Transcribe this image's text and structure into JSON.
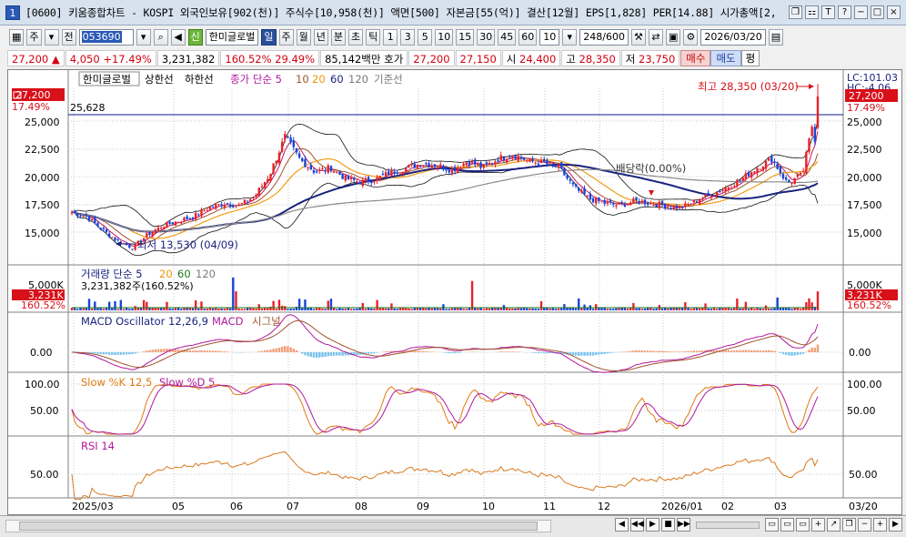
{
  "window": {
    "number": "1",
    "title": "[0600] 키움종합차트 - KOSPI 외국인보유[902(천)] 주식수[10,958(천)] 액면[500] 자본금[55(억)] 결산[12월] EPS[1,828] PER[14.88] 시가총액[2,"
  },
  "toolbar": {
    "mode1": "주",
    "mode2": "전",
    "code": "053690",
    "badge": "신",
    "name": "한미글로벌",
    "periods": [
      "일",
      "주",
      "월",
      "년",
      "분",
      "초",
      "틱"
    ],
    "numbers": [
      "1",
      "3",
      "5",
      "10",
      "15",
      "30",
      "45",
      "60"
    ],
    "select_value": "10",
    "page_count": "248/600",
    "date": "2026/03/20"
  },
  "info": {
    "price": "27,200",
    "change": "4,050",
    "change_pct": "+17.49%",
    "volume": "3,231,382",
    "volume_pct": "160.52%",
    "turnover": "29.49%",
    "amount": "85,142백만",
    "ask_label": "호가",
    "ask": "27,200",
    "bid": "27,150",
    "open_label": "시",
    "open": "24,400",
    "high_label": "고",
    "high": "28,350",
    "low_label": "저",
    "low": "23,750",
    "buy": "매수",
    "sell": "매도",
    "avg": "평"
  },
  "legend": {
    "name": "한미글로벌",
    "upper": "상한선",
    "lower": "하한선",
    "ma_label": "종가 단순 5",
    "ma10": "10",
    "ma20": "20",
    "ma60": "60",
    "ma120": "120",
    "base": "기준선"
  },
  "price_pane": {
    "current_price": "27,200",
    "current_pct": "17.49%",
    "ref_line": "25,628",
    "high_note": "최고 28,350 (03/20)",
    "low_note": "최저 13,530 (04/09)",
    "dividend_note": "배당락(0.00%)",
    "lc": "LC:101.03",
    "hc": "HC:-4.06",
    "ticks": [
      "25,000",
      "22,500",
      "20,000",
      "17,500",
      "15,000"
    ]
  },
  "volume_pane": {
    "legend_label": "거래량 단순 5",
    "ma20": "20",
    "ma60": "60",
    "ma120": "120",
    "detail": "3,231,382주(160.52%)",
    "tick": "5,000K",
    "current": "3,231K",
    "pct": "160.52%"
  },
  "macd_pane": {
    "label1": "MACD Oscillator 12,26,9",
    "label2": "MACD",
    "label3": "시그널",
    "tick": "0.00"
  },
  "stoch_pane": {
    "label1": "Slow %K 12,5",
    "label2": "Slow %D 5",
    "ticks": [
      "100.00",
      "50.00"
    ]
  },
  "rsi_pane": {
    "label": "RSI 14",
    "tick": "50.00"
  },
  "xaxis": [
    "2025/03",
    "05",
    "06",
    "07",
    "08",
    "09",
    "10",
    "11",
    "12",
    "2026/01",
    "02",
    "03"
  ],
  "xaxis_right": "03/20",
  "chart_data": {
    "type": "candlestick",
    "series": [
      {
        "name": "종가",
        "values": [
          16800,
          16400,
          15200,
          14200,
          13600,
          14800,
          15600,
          16000,
          16400,
          17200,
          17600,
          17400,
          18200,
          20200,
          23600,
          21500,
          20400,
          20800,
          19800,
          19500,
          19800,
          20400,
          20800,
          21200,
          21000,
          20600,
          21400,
          20800,
          21600,
          22000,
          21400,
          21200,
          20800,
          19000,
          18000,
          17600,
          17400,
          17800,
          17600,
          17400,
          17200,
          17800,
          18400,
          19000,
          19800,
          20800,
          21600,
          19400,
          20200,
          27200
        ]
      }
    ],
    "colors": {
      "up": "#e8222a",
      "down": "#1744d8",
      "ma5": "#c2185b",
      "ma10": "#a0522d",
      "ma20": "#f39c12",
      "ma60": "#1a237e",
      "ma120": "#8a8a8a"
    }
  }
}
